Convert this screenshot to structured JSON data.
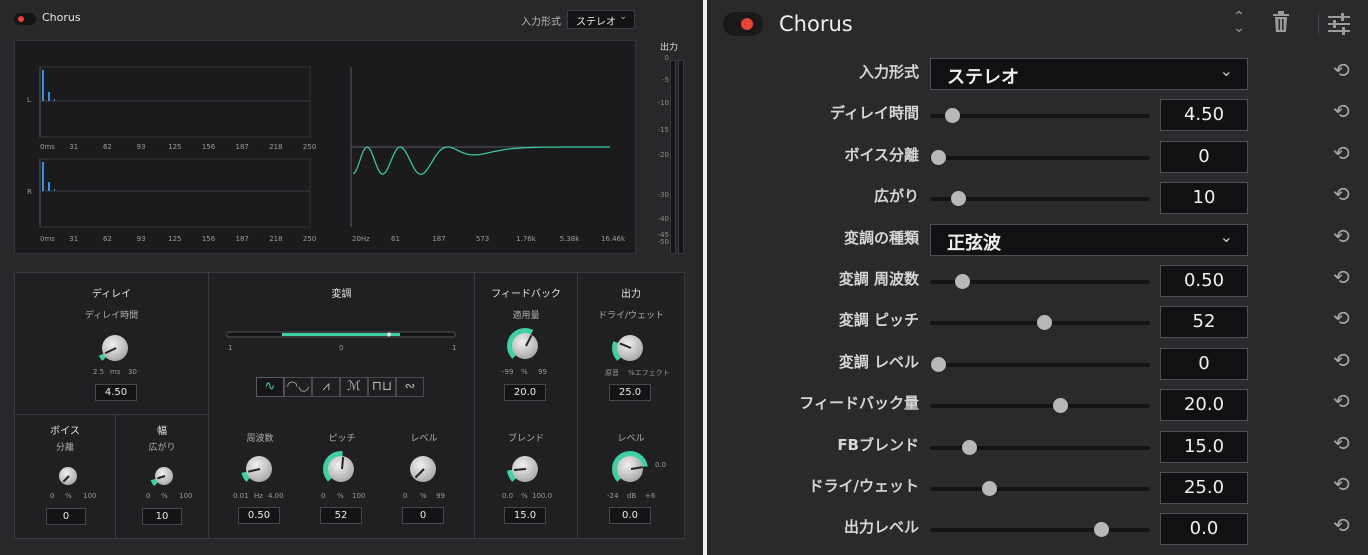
{
  "left": {
    "title": "Chorus",
    "input_label": "入力形式",
    "input_value": "ステレオ",
    "chev": "⌄",
    "output_label": "出力",
    "graph": {
      "ch_l": "L",
      "ch_r": "R",
      "time_ticks": [
        "0ms",
        "31",
        "62",
        "93",
        "125",
        "156",
        "187",
        "218",
        "250"
      ],
      "freq_ticks": [
        "20Hz",
        "61",
        "187",
        "573",
        "1.76k",
        "5.38k",
        "16.46k"
      ]
    },
    "meter_ticks": [
      "0",
      "-5",
      "-10",
      "-15",
      "-20",
      "-30",
      "-40",
      "-45",
      "-50"
    ],
    "delay": {
      "title": "ディレイ",
      "knob_label": "ディレイ時間",
      "r_min": "2.5",
      "r_unit": "ms",
      "r_max": "30",
      "value": "4.50",
      "fraction": 0.07
    },
    "voice": {
      "title": "ボイス",
      "knob_label": "分離",
      "r_min": "0",
      "r_unit": "%",
      "r_max": "100",
      "value": "0",
      "fraction": 0.0
    },
    "width": {
      "title": "幅",
      "knob_label": "広がり",
      "r_min": "0",
      "r_unit": "%",
      "r_max": "100",
      "value": "10",
      "fraction": 0.1
    },
    "mod": {
      "title": "変調",
      "range_min": "1",
      "range_mid": "0",
      "range_max": "1",
      "waves": [
        "∿",
        "◠◡",
        "⩘",
        "ℳ",
        "⊓⊔",
        "∾"
      ],
      "freq": {
        "label": "周波数",
        "r_min": "0.01",
        "r_unit": "Hz",
        "r_max": "4.00",
        "value": "0.50",
        "fraction": 0.12
      },
      "pitch": {
        "label": "ピッチ",
        "r_min": "0",
        "r_unit": "%",
        "r_max": "100",
        "value": "52",
        "fraction": 0.52
      },
      "level": {
        "label": "レベル",
        "r_min": "0",
        "r_unit": "%",
        "r_max": "99",
        "value": "0",
        "fraction": 0.0
      }
    },
    "feedback": {
      "title": "フィードバック",
      "amount": {
        "label": "適用量",
        "r_min": "-99",
        "r_unit": "%",
        "r_max": "99",
        "value": "20.0",
        "fraction": 0.6
      },
      "blend": {
        "label": "ブレンド",
        "r_min": "0.0",
        "r_unit": "%",
        "r_max": "100.0",
        "value": "15.0",
        "fraction": 0.15
      }
    },
    "output": {
      "title": "出力",
      "drywet": {
        "label": "ドライ/ウェット",
        "r_min": "原音",
        "r_max": "%エフェクト",
        "value": "25.0",
        "fraction": 0.25
      },
      "level": {
        "label": "レベル",
        "r_min": "-24",
        "r_unit": "dB",
        "r_max": "+6",
        "r_top": "0.0",
        "value": "0.0",
        "fraction": 0.8
      }
    },
    "colors": {
      "accent": "#3ed0a2",
      "bar": "#3b8fe0"
    }
  },
  "right": {
    "title": "Chorus",
    "icons": {
      "updown": "⌃⌄",
      "trash": "🗑",
      "settings": "☰"
    },
    "chev": "⌄",
    "reset_glyph": "⟲",
    "rows": [
      {
        "label": "入力形式",
        "type": "select",
        "value": "ステレオ"
      },
      {
        "label": "ディレイ時間",
        "type": "slider",
        "value": "4.50",
        "fraction": 0.07
      },
      {
        "label": "ボイス分離",
        "type": "slider",
        "value": "0",
        "fraction": 0.0
      },
      {
        "label": "広がり",
        "type": "slider",
        "value": "10",
        "fraction": 0.1
      },
      {
        "label": "変調の種類",
        "type": "select",
        "value": "正弦波"
      },
      {
        "label": "変調 周波数",
        "type": "slider",
        "value": "0.50",
        "fraction": 0.12
      },
      {
        "label": "変調 ピッチ",
        "type": "slider",
        "value": "52",
        "fraction": 0.52
      },
      {
        "label": "変調 レベル",
        "type": "slider",
        "value": "0",
        "fraction": 0.0
      },
      {
        "label": "フィードバック量",
        "type": "slider",
        "value": "20.0",
        "fraction": 0.6
      },
      {
        "label": "FBブレンド",
        "type": "slider",
        "value": "15.0",
        "fraction": 0.15
      },
      {
        "label": "ドライ/ウェット",
        "type": "slider",
        "value": "25.0",
        "fraction": 0.25
      },
      {
        "label": "出力レベル",
        "type": "slider",
        "value": "0.0",
        "fraction": 0.8
      }
    ]
  }
}
